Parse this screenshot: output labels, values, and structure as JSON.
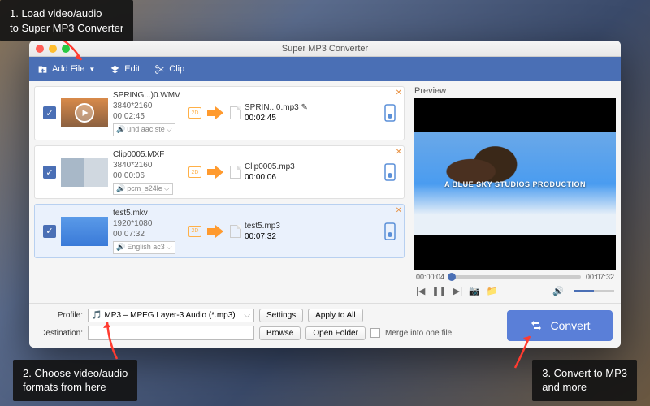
{
  "callouts": {
    "c1": "1. Load video/audio\nto Super MP3 Converter",
    "c2": "2. Choose video/audio\nformats from here",
    "c3": "3. Convert to MP3\nand more"
  },
  "window": {
    "title": "Super MP3 Converter"
  },
  "toolbar": {
    "addfile": "Add File",
    "edit": "Edit",
    "clip": "Clip"
  },
  "rows": [
    {
      "src": "SPRING...)0.WMV",
      "dim": "3840*2160",
      "dur": "00:02:45",
      "audio": "und aac ste",
      "out": "SPRIN...0.mp3",
      "outdur": "00:02:45"
    },
    {
      "src": "Clip0005.MXF",
      "dim": "3840*2160",
      "dur": "00:00:06",
      "audio": "pcm_s24le",
      "out": "Clip0005.mp3",
      "outdur": "00:00:06"
    },
    {
      "src": "test5.mkv",
      "dim": "1920*1080",
      "dur": "00:07:32",
      "audio": "English ac3",
      "out": "test5.mp3",
      "outdur": "00:07:32"
    }
  ],
  "preview": {
    "label": "Preview",
    "overlay": "A BLUE SKY STUDIOS PRODUCTION",
    "cur": "00:00:04",
    "total": "00:07:32"
  },
  "bottom": {
    "profile_label": "Profile:",
    "profile_value": "MP3 – MPEG Layer-3 Audio (*.mp3)",
    "settings": "Settings",
    "apply": "Apply to All",
    "dest_label": "Destination:",
    "browse": "Browse",
    "openfolder": "Open Folder",
    "merge": "Merge into one file",
    "convert": "Convert"
  }
}
